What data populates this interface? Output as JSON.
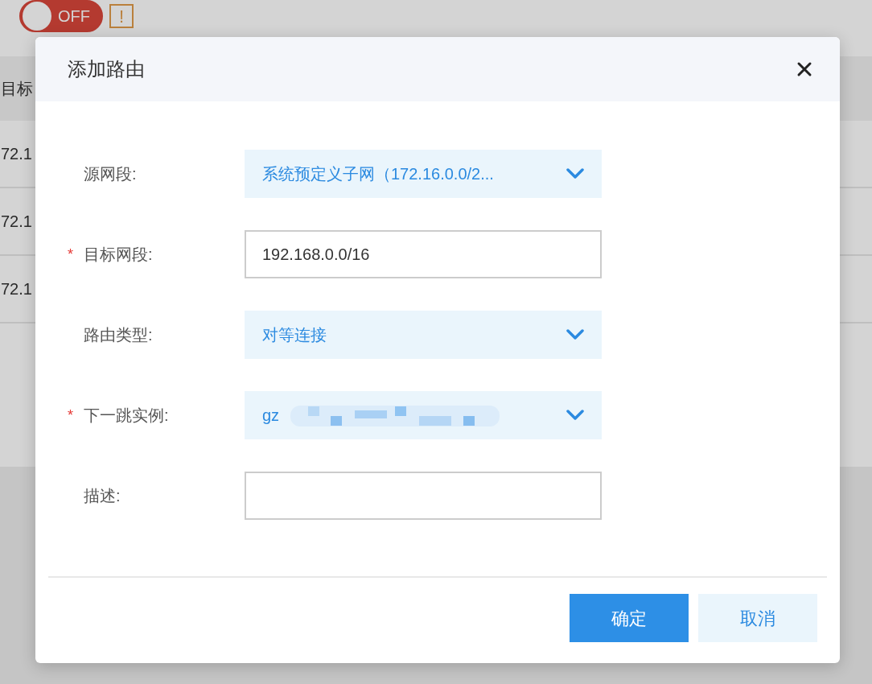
{
  "background": {
    "toggle": {
      "on": false,
      "label": "OFF"
    },
    "warning": "!",
    "table": {
      "header": "目标",
      "rows": [
        "72.1",
        "72.1",
        "72.1"
      ]
    }
  },
  "dialog": {
    "title": "添加路由",
    "fields": [
      {
        "label": "源网段:",
        "kind": "select",
        "value": "系统预定义子网（172.16.0.0/2..."
      },
      {
        "label": "目标网段:",
        "required_mark": "*",
        "kind": "input",
        "value": "192.168.0.0/16"
      },
      {
        "label": "路由类型:",
        "kind": "select",
        "value": "对等连接"
      },
      {
        "label": "下一跳实例:",
        "required_mark": "*",
        "kind": "select",
        "value": "gz",
        "redacted": true
      },
      {
        "label": "描述:",
        "kind": "input"
      }
    ],
    "buttons": [
      {
        "label": "确定",
        "primary": true
      },
      {
        "label": "取消",
        "primary": false
      }
    ]
  }
}
